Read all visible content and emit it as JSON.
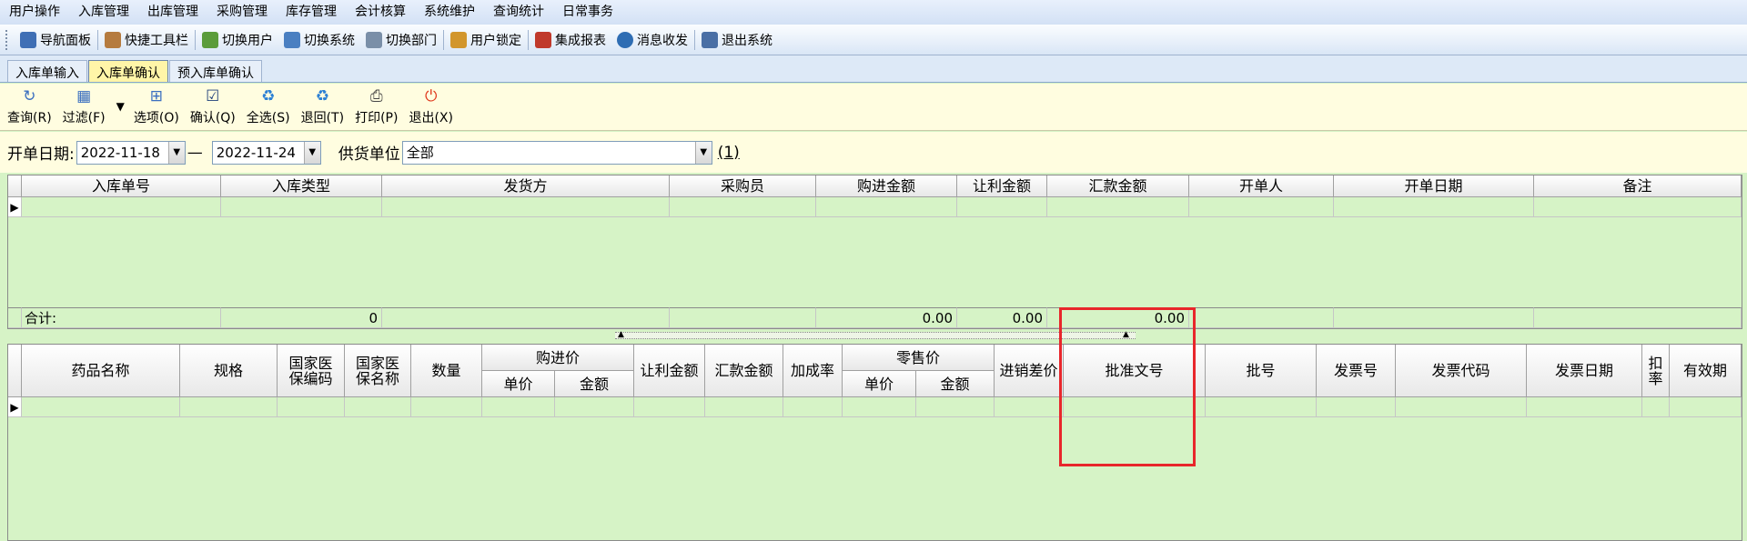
{
  "menu": [
    "用户操作",
    "入库管理",
    "出库管理",
    "采购管理",
    "库存管理",
    "会计核算",
    "系统维护",
    "查询统计",
    "日常事务"
  ],
  "toolbar": [
    {
      "label": "导航面板",
      "icon": "navigation-panel-icon",
      "color": "#3f6fb5"
    },
    {
      "label": "快捷工具栏",
      "icon": "shortcut-toolbar-icon",
      "color": "#b57b3f"
    },
    {
      "label": "切换用户",
      "icon": "switch-user-icon",
      "color": "#5b9c3a"
    },
    {
      "label": "切换系统",
      "icon": "switch-system-icon",
      "color": "#4a7fc1"
    },
    {
      "label": "切换部门",
      "icon": "switch-department-icon",
      "color": "#7a8fa8"
    },
    {
      "label": "用户锁定",
      "icon": "user-lock-icon",
      "color": "#d2962c"
    },
    {
      "label": "集成报表",
      "icon": "integrated-report-icon",
      "color": "#c0392b"
    },
    {
      "label": "消息收发",
      "icon": "message-icon",
      "color": "#2f6db3"
    },
    {
      "label": "退出系统",
      "icon": "exit-system-icon",
      "color": "#4a6fa5"
    }
  ],
  "tabs": [
    {
      "label": "入库单输入",
      "active": false
    },
    {
      "label": "入库单确认",
      "active": true
    },
    {
      "label": "预入库单确认",
      "active": false
    }
  ],
  "actions": [
    {
      "label": "查询(R)",
      "icon": "refresh-query-icon",
      "glyph": "↻",
      "color": "#3b6fc0"
    },
    {
      "label": "过滤(F)",
      "icon": "filter-icon",
      "glyph": "▦",
      "color": "#3b6fc0"
    },
    {
      "label": "选项(O)",
      "icon": "options-icon",
      "glyph": "⊞",
      "color": "#3b6fc0"
    },
    {
      "label": "确认(Q)",
      "icon": "confirm-checkbox-icon",
      "glyph": "☑",
      "color": "#1f3f7a"
    },
    {
      "label": "全选(S)",
      "icon": "select-all-icon",
      "glyph": "♻",
      "color": "#2a7fd4"
    },
    {
      "label": "退回(T)",
      "icon": "return-icon",
      "glyph": "♻",
      "color": "#2a7fd4"
    },
    {
      "label": "打印(P)",
      "icon": "print-icon",
      "glyph": "⎙",
      "color": "#444444"
    },
    {
      "label": "退出(X)",
      "icon": "power-exit-icon",
      "glyph": "⏻",
      "color": "#e03a1e"
    }
  ],
  "filter": {
    "date_label": "开单日期:",
    "date_from": "2022-11-18",
    "dash": "—",
    "date_to": "2022-11-24",
    "supplier_label": "供货单位",
    "supplier_value": "全部",
    "link": "(1)"
  },
  "top_grid": {
    "headers": [
      "入库单号",
      "入库类型",
      "发货方",
      "采购员",
      "购进金额",
      "让利金额",
      "汇款金额",
      "开单人",
      "开单日期",
      "备注"
    ],
    "total_label": "合计:",
    "totals": [
      "",
      "0",
      "",
      "",
      "0.00",
      "0.00",
      "0.00",
      "",
      "",
      ""
    ]
  },
  "bottom_grid": {
    "headers": [
      "药品名称",
      "规格",
      "国家医保编码",
      "国家医保名称",
      "数量",
      "购进价",
      "让利金额",
      "汇款金额",
      "加成率",
      "零售价",
      "进销差价",
      "批准文号",
      "批号",
      "发票号",
      "发票代码",
      "发票日期",
      "扣率",
      "有效期"
    ],
    "sub_headers": [
      "单价",
      "金额",
      "单价",
      "金额"
    ]
  },
  "colors": {
    "highlight": "#e8262b",
    "grid_bg": "#d6f3c6",
    "toolbar_bg": "#fffde0",
    "active_tab": "#fff5a8"
  }
}
